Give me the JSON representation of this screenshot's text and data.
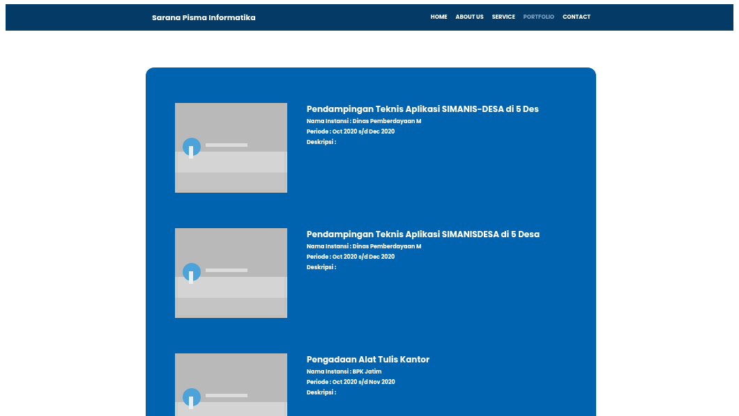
{
  "header": {
    "brand": "Sarana Pisma Informatika",
    "nav": [
      {
        "label": "HOME",
        "selected": false
      },
      {
        "label": "ABOUT US",
        "selected": false
      },
      {
        "label": "SERVICE",
        "selected": false
      },
      {
        "label": "PORTFOLIO",
        "selected": true
      },
      {
        "label": "CONTACT",
        "selected": false
      }
    ]
  },
  "portfolio": [
    {
      "title": "Pendampingan Teknis Aplikasi SIMANIS-DESA di 5 Des",
      "instansi": "Nama Instansi : Dinas Pemberdayaan M",
      "periode": "Periode : Oct 2020 s/d Dec 2020",
      "deskripsi": "Deskripsi :"
    },
    {
      "title": "Pendampingan Teknis Aplikasi SIMANISDESA di 5 Desa",
      "instansi": "Nama Instansi : Dinas Pemberdayaan M",
      "periode": "Periode : Oct 2020 s/d Dec 2020",
      "deskripsi": "Deskripsi :"
    },
    {
      "title": "Pengadaan Alat Tulis Kantor",
      "instansi": "Nama Instansi : BPK Jatim",
      "periode": "Periode : Oct 2020 s/d Nov 2020",
      "deskripsi": "Deskripsi :"
    }
  ]
}
